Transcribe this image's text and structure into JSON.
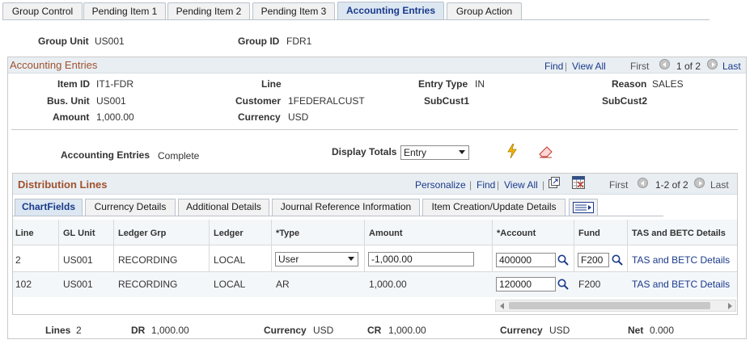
{
  "tabs": [
    "Group Control",
    "Pending Item 1",
    "Pending Item 2",
    "Pending Item 3",
    "Accounting Entries",
    "Group Action"
  ],
  "header": {
    "group_unit_label": "Group Unit",
    "group_unit": "US001",
    "group_id_label": "Group ID",
    "group_id": "FDR1"
  },
  "acct_box": {
    "title": "Accounting Entries",
    "find": "Find",
    "sep": "|",
    "view_all": "View All",
    "first": "First",
    "page": "1 of 2",
    "last": "Last"
  },
  "fields": {
    "item_id_label": "Item ID",
    "item_id": "IT1-FDR",
    "line_label": "Line",
    "line": "",
    "entry_type_label": "Entry Type",
    "entry_type": "IN",
    "reason_label": "Reason",
    "reason": "SALES",
    "bus_unit_label": "Bus. Unit",
    "bus_unit": "US001",
    "customer_label": "Customer",
    "customer": "1FEDERALCUST",
    "subcust1_label": "SubCust1",
    "subcust1": "",
    "subcust2_label": "SubCust2",
    "subcust2": "",
    "amount_label": "Amount",
    "amount": "1,000.00",
    "currency_label": "Currency",
    "currency": "USD",
    "acct_entries_label": "Accounting Entries",
    "acct_entries": "Complete",
    "display_totals_label": "Display Totals",
    "display_totals": "Entry"
  },
  "dist": {
    "title": "Distribution Lines",
    "personalize": "Personalize",
    "find": "Find",
    "view_all": "View All",
    "first": "First",
    "page": "1-2 of 2",
    "last": "Last",
    "subtabs": [
      "ChartFields",
      "Currency Details",
      "Additional Details",
      "Journal Reference Information",
      "Item Creation/Update Details"
    ],
    "columns": [
      "Line",
      "GL Unit",
      "Ledger Grp",
      "Ledger",
      "*Type",
      "Amount",
      "*Account",
      "Fund",
      "TAS and BETC Details"
    ],
    "rows": [
      {
        "line": "2",
        "gl_unit": "US001",
        "ledger_grp": "RECORDING",
        "ledger": "LOCAL",
        "type": "User",
        "amount": "-1,000.00",
        "account": "400000",
        "fund": "F200",
        "tas": "TAS and BETC Details"
      },
      {
        "line": "102",
        "gl_unit": "US001",
        "ledger_grp": "RECORDING",
        "ledger": "LOCAL",
        "type": "AR",
        "amount": "1,000.00",
        "account": "120000",
        "fund": "F200",
        "tas": "TAS and BETC Details"
      }
    ]
  },
  "totals": {
    "lines_label": "Lines",
    "lines": "2",
    "dr_label": "DR",
    "dr": "1,000.00",
    "currency1_label": "Currency",
    "currency1": "USD",
    "cr_label": "CR",
    "cr": "1,000.00",
    "currency2_label": "Currency",
    "currency2": "USD",
    "net_label": "Net",
    "net": "0.000"
  }
}
